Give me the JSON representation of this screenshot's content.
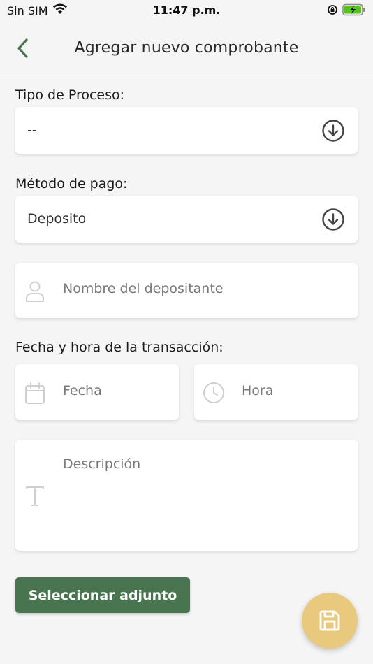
{
  "status_bar": {
    "carrier": "Sin SIM",
    "time": "11:47 p.m."
  },
  "header": {
    "title": "Agregar nuevo comprobante"
  },
  "form": {
    "tipo_proceso": {
      "label": "Tipo de Proceso:",
      "value": "--"
    },
    "metodo_pago": {
      "label": "Método de pago:",
      "value": "Deposito"
    },
    "depositante": {
      "placeholder": "Nombre del depositante"
    },
    "fecha_hora": {
      "label": "Fecha y hora de la transacción:",
      "fecha_placeholder": "Fecha",
      "hora_placeholder": "Hora"
    },
    "descripcion": {
      "placeholder": "Descripción"
    },
    "attach_button": "Seleccionar adjunto"
  },
  "colors": {
    "primary_green": "#487550",
    "fab_yellow": "#e8c97e",
    "icon_gray": "#cfcfcf"
  },
  "icons": {
    "back": "chevron-left-icon",
    "dropdown": "arrow-down-circle-icon",
    "person": "user-icon",
    "calendar": "calendar-icon",
    "clock": "clock-icon",
    "text": "text-icon",
    "save": "save-icon",
    "wifi": "wifi-icon",
    "battery": "battery-charging-icon",
    "orientation_lock": "orientation-lock-icon"
  }
}
